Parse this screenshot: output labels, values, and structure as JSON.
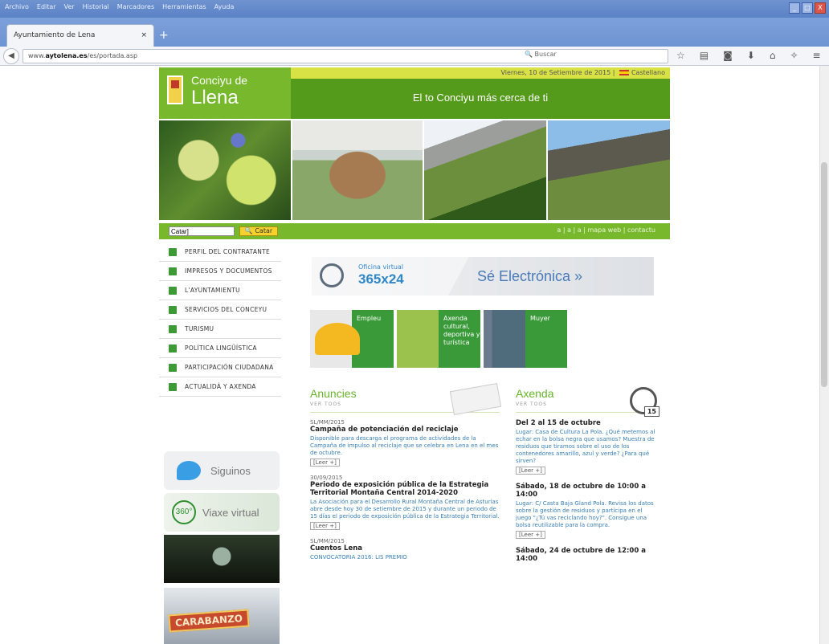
{
  "browser": {
    "menu": [
      "Archivo",
      "Editar",
      "Ver",
      "Historial",
      "Marcadores",
      "Herramientas",
      "Ayuda"
    ],
    "tab_title": "Ayuntamiento de Lena",
    "close_tab": "×",
    "new_tab": "+",
    "back": "◀",
    "url_prefix": "www.",
    "url_host": "aytolena.es",
    "url_path": "/es/portada.asp",
    "search_placeholder": "Buscar",
    "window_btns": [
      "_",
      "□",
      "X"
    ]
  },
  "site": {
    "logo_line1": "Conciyu de",
    "logo_line2": "Llena",
    "date_text": "Viernes, 10 de Setiembre de 2015 |",
    "language": "Castellano",
    "slogan": "El to Conciyu más cerca de ti",
    "search_value": "Catar]",
    "search_button": "Catar",
    "utility_links": "a | a | a | mapa web | contactu",
    "menu": [
      "PERFIL DEL CONTRATANTE",
      "IMPRESOS Y DOCUMENTOS",
      "L'AYUNTAMIENTU",
      "SERVICIOS DEL CONCEYU",
      "TURISMU",
      "POLÍTICA LINGÜÍSTICA",
      "PARTICIPACIÓN CIUDADANA",
      "ACTUALIDÁ Y AXENDA"
    ],
    "twitter": "Siguinos",
    "virtual": "Viaxe virtual",
    "virtual_badge": "360°",
    "banner2_text": "CARABANZO",
    "banner1_text": "",
    "office_small": "Oficina virtual",
    "office_big": "365x24",
    "electronic": "Sé Electrónica »",
    "tiles": [
      {
        "label": "Empleu"
      },
      {
        "label": "Axenda cultural, deportiva y turística"
      },
      {
        "label": "Muyer"
      }
    ],
    "announcements": {
      "title": "Anuncies",
      "sub": "VER TOOS",
      "items": [
        {
          "date": "SL/MM/2015",
          "title": "Campaña de potenciación del reciclaje",
          "body": "Disponible para descarga el programa de actividades de la Campaña de impulso al reciclaje que se celebra en Lena en el mes de octubre.",
          "more": "[Leer +]"
        },
        {
          "date": "30/09/2015",
          "title": "Periodo de exposición pública de la Estrategia Territorial Montaña Central 2014-2020",
          "body": "La Asociación para el Desarrollo Rural Montaña Central de Asturias abre desde hoy 30 de setiembre de 2015 y durante un periodo de 15 días el periodo de exposición pública de la Estrategia Territorial.",
          "more": "[Leer +]"
        },
        {
          "date": "SL/MM/2015",
          "title": "Cuentos Lena",
          "body": "CONVOCATORIA 2016: LIS PREMIO",
          "more": ""
        }
      ]
    },
    "agenda": {
      "title": "Axenda",
      "sub": "VER TOOS",
      "cal_day": "15",
      "items": [
        {
          "date": "",
          "title": "Del 2 al 15 de octubre",
          "body": "Lugar: Casa de Cultura La Pola. ¿Qué metemos al echar en la bolsa negra que usamos? Muestra de residuos que tiramos sobre el uso de los contenedores amarillo, azul y verde? ¿Para qué sirven?",
          "more": "[Leer +]"
        },
        {
          "date": "",
          "title": "Sábado, 18 de octubre de 10:00 a 14:00",
          "body": "Lugar: C/ Casta Baja Gland Pola. Revisa los datos sobre la gestión de residuos y participa en el juego \"¿Tú vas reciclando hoy?\". Consigue una bolsa reutilizable para la compra.",
          "more": "[Leer +]"
        },
        {
          "date": "",
          "title": "Sábado, 24 de octubre de 12:00 a 14:00",
          "body": "",
          "more": ""
        }
      ]
    }
  }
}
